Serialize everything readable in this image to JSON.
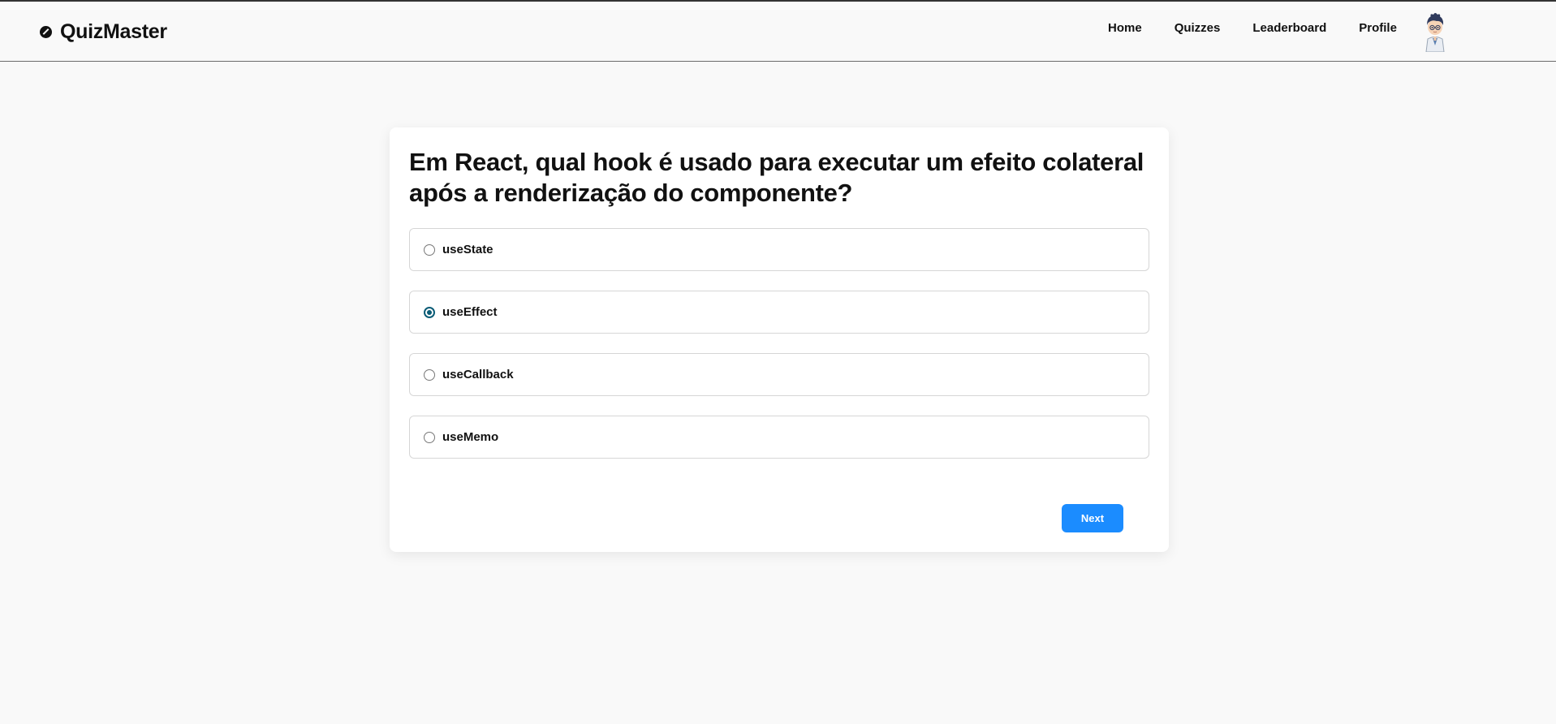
{
  "brand": {
    "name": "QuizMaster",
    "icon": "basketball-icon"
  },
  "nav": {
    "items": [
      "Home",
      "Quizzes",
      "Leaderboard",
      "Profile"
    ]
  },
  "user": {
    "avatar_icon": "user-avatar-cartoon"
  },
  "quiz": {
    "question": "Em React, qual hook é usado para executar um efeito colateral após a renderização do componente?",
    "options": [
      "useState",
      "useEffect",
      "useCallback",
      "useMemo"
    ],
    "selected": "useEffect",
    "next_label": "Next"
  },
  "colors": {
    "accent": "#1b8cff",
    "radio_checked": "#0b5c76",
    "background": "#f9f9f9"
  }
}
